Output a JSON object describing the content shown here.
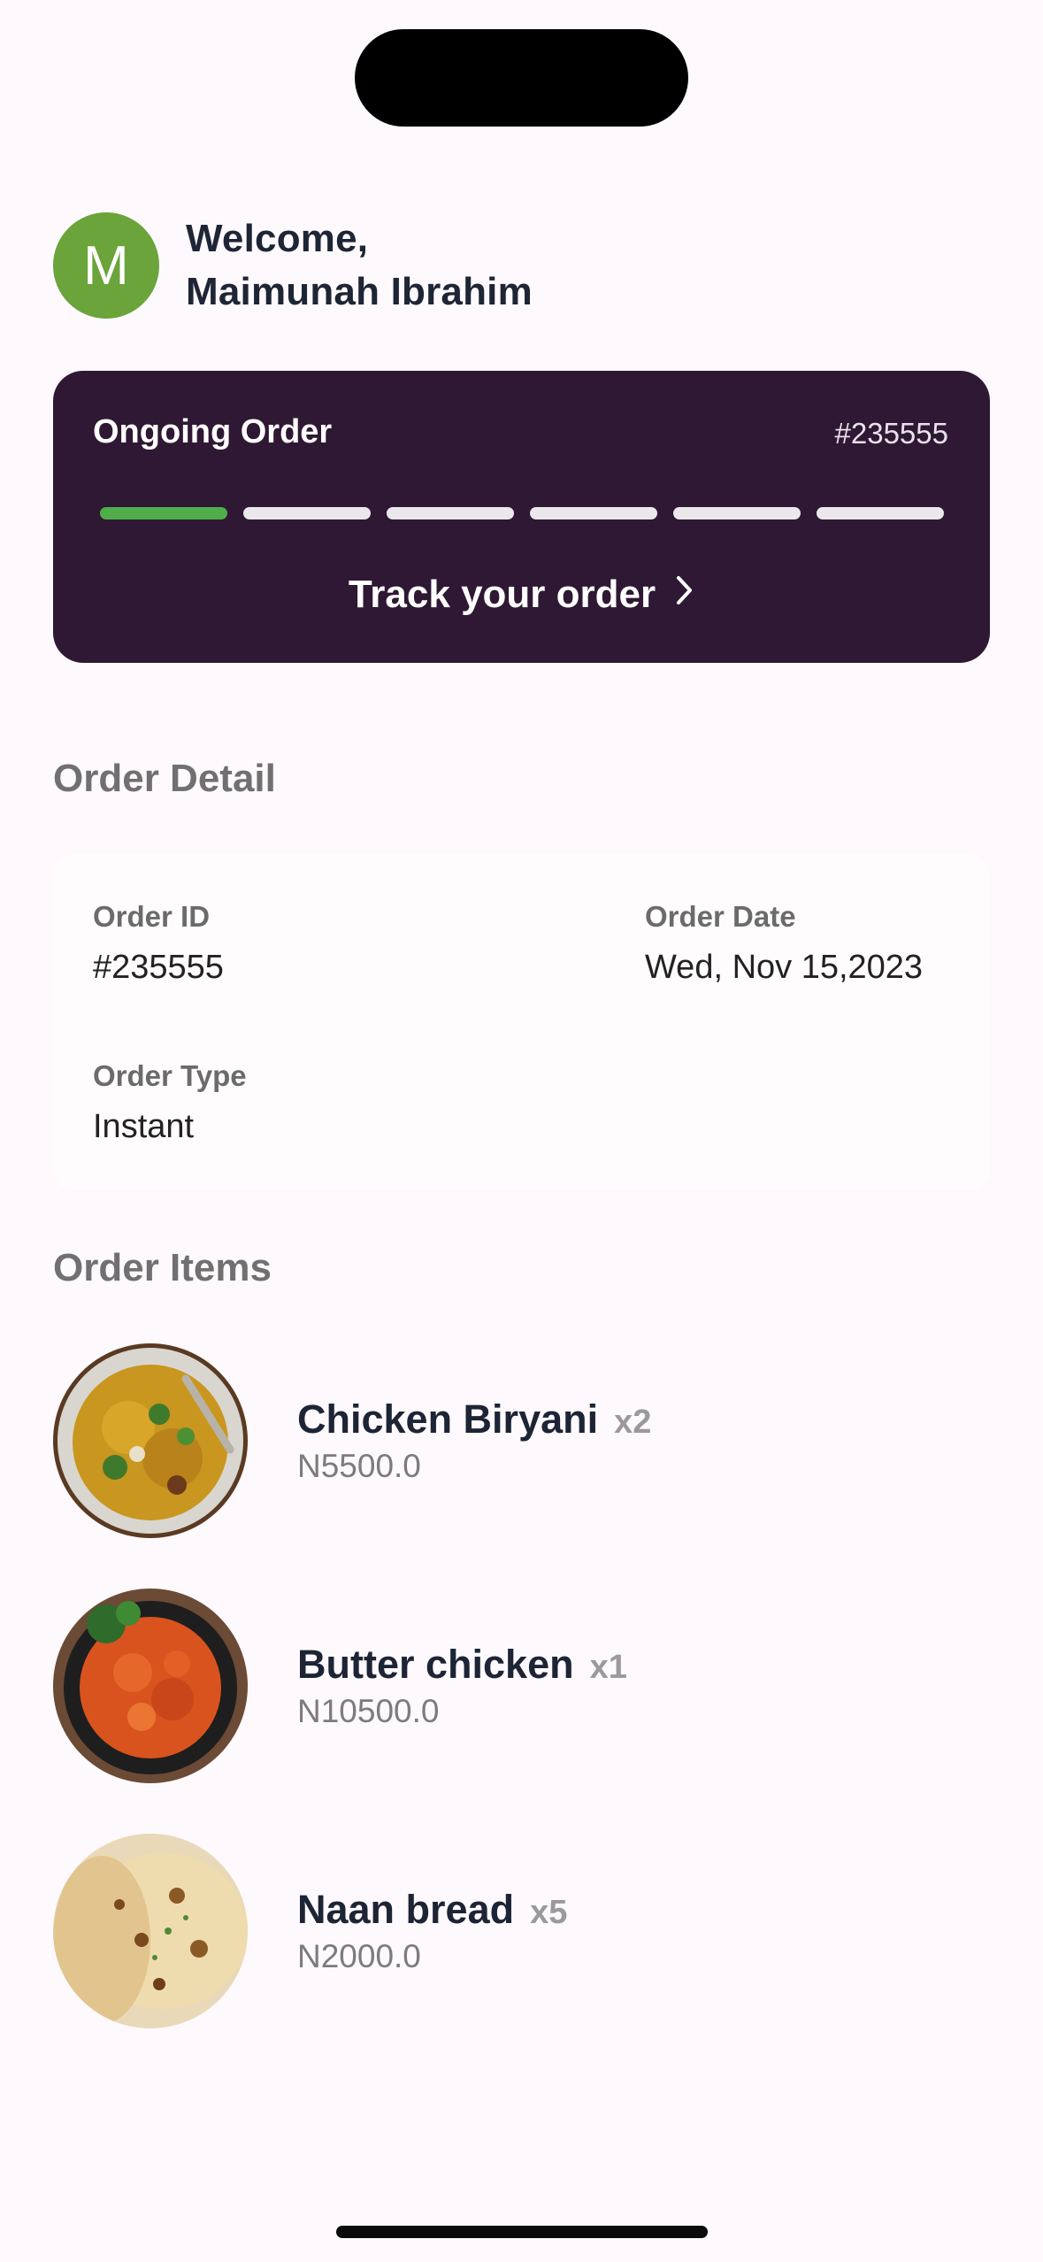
{
  "header": {
    "avatar_initial": "M",
    "welcome_line1": "Welcome,",
    "welcome_line2": "Maimunah Ibrahim"
  },
  "ongoing_order": {
    "title": "Ongoing Order",
    "order_number": "#235555",
    "progress_completed_steps": 1,
    "progress_total_steps": 6,
    "track_label": "Track your order"
  },
  "order_detail": {
    "section_title": "Order Detail",
    "order_id_label": "Order ID",
    "order_id_value": "#235555",
    "order_date_label": "Order Date",
    "order_date_value": "Wed, Nov 15,2023",
    "order_type_label": "Order Type",
    "order_type_value": "Instant"
  },
  "order_items": {
    "section_title": "Order Items",
    "items": [
      {
        "name": "Chicken Biryani",
        "qty": "x2",
        "price": "N5500.0"
      },
      {
        "name": "Butter chicken",
        "qty": "x1",
        "price": "N10500.0"
      },
      {
        "name": "Naan bread",
        "qty": "x5",
        "price": "N2000.0"
      }
    ]
  },
  "colors": {
    "background": "#fdf9fc",
    "card_dark": "#2f1833",
    "progress_done": "#4fae4a",
    "progress_todo": "#ebe8ec",
    "avatar": "#6aa43a"
  }
}
